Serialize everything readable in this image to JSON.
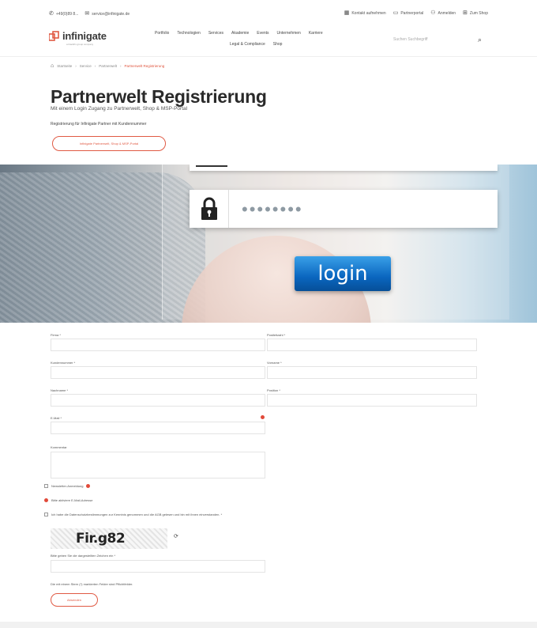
{
  "topbar": {
    "phone": "+49(0)89 8...",
    "email": "service@infinigate.de",
    "items": [
      "Kontakt aufnehmen",
      "Partnerportal",
      "Anmelden",
      "Zum Shop"
    ]
  },
  "header": {
    "logo_text": "infinigate",
    "logo_tag": "a blackfin group company",
    "nav_row1": [
      "Portfolio",
      "Technologien",
      "Services",
      "Akademie",
      "Events",
      "Unternehmen",
      "Karriere"
    ],
    "nav_row2": [
      "Legal & Compliance",
      "Shop"
    ],
    "search_placeholder": "Suchen Suchbegriff"
  },
  "breadcrumb": [
    "Startseite",
    "Service",
    "Partnerwelt",
    "Partnerwelt Registrierung"
  ],
  "page": {
    "title": "Partnerwelt Registrierung",
    "subtitle": "Mit einem Login Zugang zu Partnerwelt, Shop & MSP-Portal",
    "intro": "Registrierung für Infinigate Partner mit Kundennummer",
    "cta": "Infinigate Partnerwelt, Shop & MSP-Portal"
  },
  "hero": {
    "password_mask": "••••••••",
    "login_label": "login"
  },
  "form": {
    "firma_label": "Firma *",
    "kundennummer_label": "Kundennummer *",
    "nachname_label": "Nachname *",
    "email_label": "E-Mail *",
    "kommentar_label": "Kommentar",
    "postleitzahl_label": "Postleitzahl *",
    "vorname_label": "Vorname *",
    "position_label": "Position *",
    "newsletter_label": "Newsletter-Anmeldung",
    "mail_notice": "Bitte aktiviere E-Mail-Adresse",
    "privacy_label": "Ich habe die Datenschutzbestimmungen zur Kenntnis genommen und die AGB gelesen und bin mit ihnen einverstanden. *",
    "captcha_text": "Fir.g82",
    "captcha_prompt": "Bitte geben Sie die dargestellten Zeichen ein *",
    "required_note": "Die mit einem Stern (*) markierten Felder sind Pflichtfelder.",
    "submit_label": "Absenden"
  },
  "colors": {
    "accent": "#e05a44",
    "login_blue": "#0a66bf"
  }
}
